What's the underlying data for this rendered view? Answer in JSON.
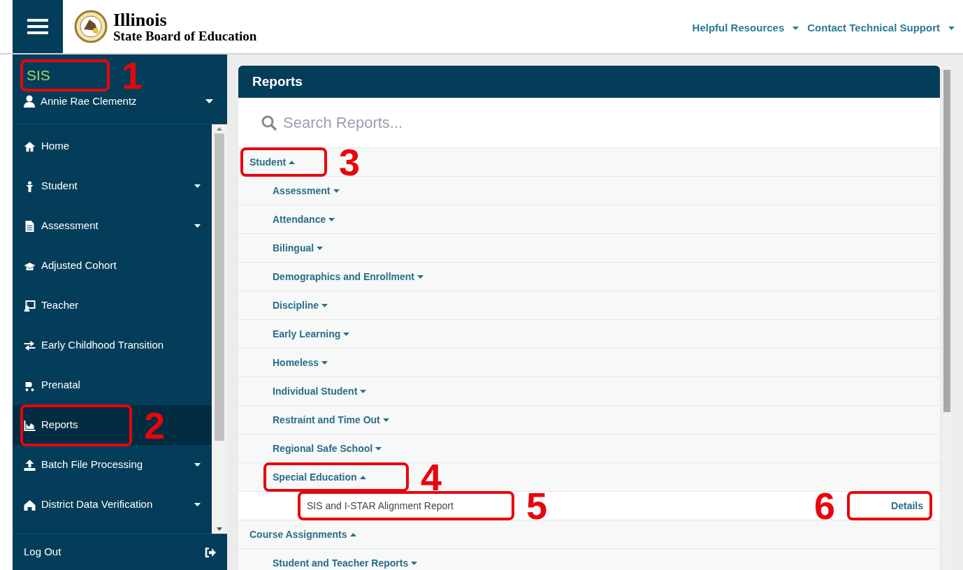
{
  "header": {
    "logo_title": "Illinois",
    "logo_subtitle": "State Board of Education",
    "links": [
      {
        "label": "Helpful Resources"
      },
      {
        "label": "Contact Technical Support"
      }
    ]
  },
  "sidebar": {
    "app_name": "SIS",
    "app_annotation": "1",
    "user": "Annie Rae Clementz",
    "items": [
      {
        "label": "Home",
        "has_submenu": false,
        "selected": false
      },
      {
        "label": "Student",
        "has_submenu": true,
        "selected": false
      },
      {
        "label": "Assessment",
        "has_submenu": true,
        "selected": false
      },
      {
        "label": "Adjusted Cohort",
        "has_submenu": false,
        "selected": false
      },
      {
        "label": "Teacher",
        "has_submenu": false,
        "selected": false
      },
      {
        "label": "Early Childhood Transition",
        "has_submenu": false,
        "selected": false
      },
      {
        "label": "Prenatal",
        "has_submenu": false,
        "selected": false
      },
      {
        "label": "Reports",
        "has_submenu": false,
        "selected": true,
        "annotation": "2"
      },
      {
        "label": "Batch File Processing",
        "has_submenu": true,
        "selected": false
      },
      {
        "label": "District Data Verification",
        "has_submenu": true,
        "selected": false
      }
    ],
    "logout": "Log Out"
  },
  "panel": {
    "title": "Reports",
    "search_placeholder": "Search Reports...",
    "tree": [
      {
        "label": "Student",
        "expanded": true,
        "annotation": "3",
        "children": [
          {
            "label": "Assessment",
            "expanded": false
          },
          {
            "label": "Attendance",
            "expanded": false
          },
          {
            "label": "Bilingual",
            "expanded": false
          },
          {
            "label": "Demographics and Enrollment",
            "expanded": false
          },
          {
            "label": "Discipline",
            "expanded": false
          },
          {
            "label": "Early Learning",
            "expanded": false
          },
          {
            "label": "Homeless",
            "expanded": false
          },
          {
            "label": "Individual Student",
            "expanded": false
          },
          {
            "label": "Restraint and Time Out",
            "expanded": false
          },
          {
            "label": "Regional Safe School",
            "expanded": false
          },
          {
            "label": "Special Education",
            "expanded": true,
            "annotation": "4",
            "children": [
              {
                "label": "SIS and I-STAR Alignment Report",
                "kind": "report",
                "action": "Details",
                "annotation": "5",
                "action_annotation": "6"
              }
            ]
          }
        ]
      },
      {
        "label": "Course Assignments",
        "expanded": true,
        "children": [
          {
            "label": "Student and Teacher Reports",
            "expanded": false
          }
        ]
      }
    ]
  }
}
